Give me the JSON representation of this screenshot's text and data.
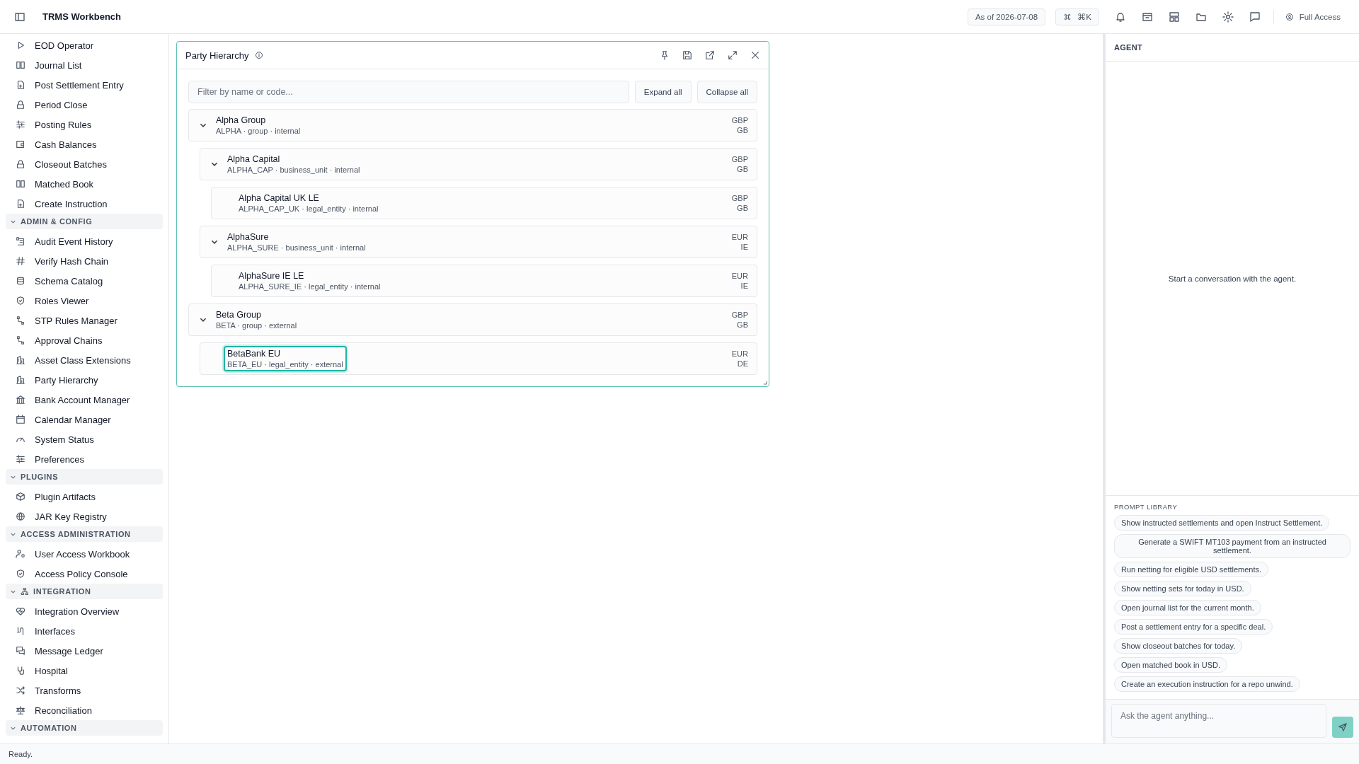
{
  "app": {
    "title": "TRMS Workbench",
    "as_of": "As of 2026-07-08",
    "command_shortcut": "⌘K",
    "access": "Full Access"
  },
  "sidebar": {
    "items": [
      {
        "label": "EOD Operator"
      },
      {
        "label": "Journal List"
      },
      {
        "label": "Post Settlement Entry"
      },
      {
        "label": "Period Close"
      },
      {
        "label": "Posting Rules"
      },
      {
        "label": "Cash Balances"
      },
      {
        "label": "Closeout Batches"
      },
      {
        "label": "Matched Book"
      },
      {
        "label": "Create Instruction"
      }
    ],
    "sections": [
      {
        "title": "ADMIN & CONFIG",
        "expanded": true,
        "items": [
          {
            "label": "Audit Event History"
          },
          {
            "label": "Verify Hash Chain"
          },
          {
            "label": "Schema Catalog"
          },
          {
            "label": "Roles Viewer"
          },
          {
            "label": "STP Rules Manager"
          },
          {
            "label": "Approval Chains"
          },
          {
            "label": "Asset Class Extensions"
          },
          {
            "label": "Party Hierarchy"
          },
          {
            "label": "Bank Account Manager"
          },
          {
            "label": "Calendar Manager"
          },
          {
            "label": "System Status"
          },
          {
            "label": "Preferences"
          }
        ]
      },
      {
        "title": "PLUGINS",
        "expanded": true,
        "items": [
          {
            "label": "Plugin Artifacts"
          },
          {
            "label": "JAR Key Registry"
          }
        ]
      },
      {
        "title": "ACCESS ADMINISTRATION",
        "expanded": true,
        "items": [
          {
            "label": "User Access Workbook"
          },
          {
            "label": "Access Policy Console"
          }
        ]
      },
      {
        "title": "INTEGRATION",
        "expanded": true,
        "items": [
          {
            "label": "Integration Overview"
          },
          {
            "label": "Interfaces"
          },
          {
            "label": "Message Ledger"
          },
          {
            "label": "Hospital"
          },
          {
            "label": "Transforms"
          },
          {
            "label": "Reconciliation"
          }
        ]
      },
      {
        "title": "AUTOMATION",
        "expanded": true
      }
    ]
  },
  "panel": {
    "title": "Party Hierarchy",
    "filter_placeholder": "Filter by name or code...",
    "buttons": [
      "Expand all",
      "Collapse all"
    ],
    "tree": [
      {
        "name": "Alpha Group",
        "meta": "ALPHA · group · internal",
        "currency": "GBP",
        "country": "GB",
        "expanded": true,
        "selected": false,
        "children": [
          {
            "name": "Alpha Capital",
            "meta": "ALPHA_CAP · business_unit · internal",
            "currency": "GBP",
            "country": "GB",
            "expanded": true,
            "selected": false,
            "children": [
              {
                "name": "Alpha Capital UK LE",
                "meta": "ALPHA_CAP_UK · legal_entity · internal",
                "currency": "GBP",
                "country": "GB",
                "selected": false
              }
            ]
          },
          {
            "name": "AlphaSure",
            "meta": "ALPHA_SURE · business_unit · internal",
            "currency": "EUR",
            "country": "IE",
            "expanded": true,
            "selected": false,
            "children": [
              {
                "name": "AlphaSure IE LE",
                "meta": "ALPHA_SURE_IE · legal_entity · internal",
                "currency": "EUR",
                "country": "IE",
                "selected": false
              }
            ]
          }
        ]
      },
      {
        "name": "Beta Group",
        "meta": "BETA · group · external",
        "currency": "GBP",
        "country": "GB",
        "expanded": true,
        "selected": false,
        "children": [
          {
            "name": "BetaBank EU",
            "meta": "BETA_EU · legal_entity · external",
            "currency": "EUR",
            "country": "DE",
            "selected": true
          }
        ]
      }
    ]
  },
  "agent": {
    "title": "AGENT",
    "empty_message": "Start a conversation with the agent.",
    "library_title": "PROMPT LIBRARY",
    "prompts": [
      "Show instructed settlements and open Instruct Settlement.",
      "Generate a SWIFT MT103 payment from an instructed settlement.",
      "Run netting for eligible USD settlements.",
      "Show netting sets for today in USD.",
      "Open journal list for the current month.",
      "Post a settlement entry for a specific deal.",
      "Show closeout batches for today.",
      "Open matched book in USD.",
      "Create an execution instruction for a repo unwind."
    ],
    "input_placeholder": "Ask the agent anything..."
  },
  "status_bar": "Ready."
}
